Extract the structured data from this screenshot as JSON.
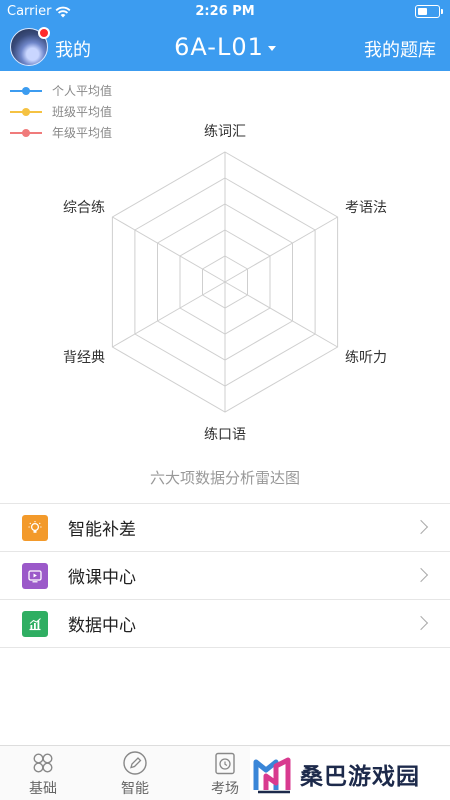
{
  "status_bar": {
    "carrier": "Carrier",
    "time": "2:26 PM"
  },
  "nav": {
    "mine_label": "我的",
    "title": "6A-L01",
    "question_bank_label": "我的题库"
  },
  "legend": [
    {
      "label": "个人平均值",
      "color": "#3c9cf0"
    },
    {
      "label": "班级平均值",
      "color": "#f5c242"
    },
    {
      "label": "年级平均值",
      "color": "#f07b7b"
    }
  ],
  "radar": {
    "axes": [
      "练词汇",
      "考语法",
      "练听力",
      "练口语",
      "背经典",
      "综合练"
    ],
    "caption": "六大项数据分析雷达图"
  },
  "menu": [
    {
      "label": "智能补差",
      "icon": "lightbulb-icon",
      "color": "#f39a2b"
    },
    {
      "label": "微课中心",
      "icon": "video-play-icon",
      "color": "#9b59c9"
    },
    {
      "label": "数据中心",
      "icon": "bar-chart-icon",
      "color": "#2fae62"
    }
  ],
  "tabs": [
    {
      "label": "基础",
      "icon": "clover-icon"
    },
    {
      "label": "智能",
      "icon": "pencil-circle-icon"
    },
    {
      "label": "考场",
      "icon": "clock-clipboard-icon"
    }
  ],
  "watermark": {
    "text": "桑巴游戏园"
  }
}
